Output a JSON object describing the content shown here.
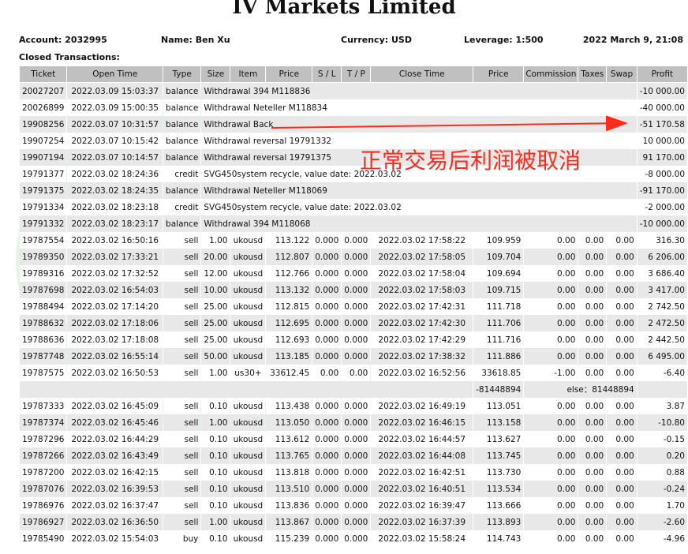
{
  "report_title": "IV Markets Limited",
  "account": {
    "account_label": "Account: 2032995",
    "name_label": "Name: Ben Xu",
    "currency_label": "Currency: USD",
    "leverage_label": "Leverage: 1:500",
    "datetime_label": "2022 March 9, 21:08"
  },
  "section_label": "Closed Transactions:",
  "columns": [
    "Ticket",
    "Open Time",
    "Type",
    "Size",
    "Item",
    "Price",
    "S / L",
    "T / P",
    "Close Time",
    "Price",
    "Commission",
    "Taxes",
    "Swap",
    "Profit"
  ],
  "balance_rows": [
    {
      "ticket": "20027207",
      "open_time": "2022.03.09 15:03:37",
      "type": "balance",
      "comment": "Withdrawal 394 M118836",
      "profit": "-10 000.00"
    },
    {
      "ticket": "20026899",
      "open_time": "2022.03.09 15:00:35",
      "type": "balance",
      "comment": "Withdrawal Neteller M118834",
      "profit": "-40 000.00"
    },
    {
      "ticket": "19908256",
      "open_time": "2022.03.07 10:31:57",
      "type": "balance",
      "comment": "Withdrawal Back",
      "profit": "-51 170.58"
    },
    {
      "ticket": "19907254",
      "open_time": "2022.03.07 10:15:42",
      "type": "balance",
      "comment": "Withdrawal reversal 19791332",
      "profit": "10 000.00"
    },
    {
      "ticket": "19907194",
      "open_time": "2022.03.07 10:14:57",
      "type": "balance",
      "comment": "Withdrawal reversal 19791375",
      "profit": "91 170.00"
    },
    {
      "ticket": "19791377",
      "open_time": "2022.03.02 18:24:36",
      "type": "credit",
      "comment": "SVG450system recycle, value date: 2022.03.02",
      "profit": "-8 000.00"
    },
    {
      "ticket": "19791375",
      "open_time": "2022.03.02 18:24:35",
      "type": "balance",
      "comment": "Withdrawal Neteller M118069",
      "profit": "-91 170.00"
    },
    {
      "ticket": "19791334",
      "open_time": "2022.03.02 18:23:18",
      "type": "credit",
      "comment": "SVG450system recycle, value date: 2022.03.02",
      "profit": "-2 000.00"
    },
    {
      "ticket": "19791332",
      "open_time": "2022.03.02 18:23:17",
      "type": "balance",
      "comment": "Withdrawal 394 M118068",
      "profit": "-10 000.00"
    }
  ],
  "trade_rows_a": [
    {
      "ticket": "19787554",
      "open_time": "2022.03.02 16:50:16",
      "type": "sell",
      "size": "1.00",
      "item": "ukousd",
      "price": "113.122",
      "sl": "0.000",
      "tp": "0.000",
      "close_time": "2022.03.02 17:58:22",
      "close_price": "109.959",
      "commission": "0.00",
      "taxes": "0.00",
      "swap": "0.00",
      "profit": "316.30"
    },
    {
      "ticket": "19789350",
      "open_time": "2022.03.02 17:33:21",
      "type": "sell",
      "size": "20.00",
      "item": "ukousd",
      "price": "112.807",
      "sl": "0.000",
      "tp": "0.000",
      "close_time": "2022.03.02 17:58:05",
      "close_price": "109.704",
      "commission": "0.00",
      "taxes": "0.00",
      "swap": "0.00",
      "profit": "6 206.00"
    },
    {
      "ticket": "19789316",
      "open_time": "2022.03.02 17:32:52",
      "type": "sell",
      "size": "12.00",
      "item": "ukousd",
      "price": "112.766",
      "sl": "0.000",
      "tp": "0.000",
      "close_time": "2022.03.02 17:58:04",
      "close_price": "109.694",
      "commission": "0.00",
      "taxes": "0.00",
      "swap": "0.00",
      "profit": "3 686.40"
    },
    {
      "ticket": "19787698",
      "open_time": "2022.03.02 16:54:03",
      "type": "sell",
      "size": "10.00",
      "item": "ukousd",
      "price": "113.132",
      "sl": "0.000",
      "tp": "0.000",
      "close_time": "2022.03.02 17:58:03",
      "close_price": "109.715",
      "commission": "0.00",
      "taxes": "0.00",
      "swap": "0.00",
      "profit": "3 417.00"
    },
    {
      "ticket": "19788494",
      "open_time": "2022.03.02 17:14:20",
      "type": "sell",
      "size": "25.00",
      "item": "ukousd",
      "price": "112.815",
      "sl": "0.000",
      "tp": "0.000",
      "close_time": "2022.03.02 17:42:31",
      "close_price": "111.718",
      "commission": "0.00",
      "taxes": "0.00",
      "swap": "0.00",
      "profit": "2 742.50"
    },
    {
      "ticket": "19788632",
      "open_time": "2022.03.02 17:18:06",
      "type": "sell",
      "size": "25.00",
      "item": "ukousd",
      "price": "112.695",
      "sl": "0.000",
      "tp": "0.000",
      "close_time": "2022.03.02 17:42:30",
      "close_price": "111.706",
      "commission": "0.00",
      "taxes": "0.00",
      "swap": "0.00",
      "profit": "2 472.50"
    },
    {
      "ticket": "19788636",
      "open_time": "2022.03.02 17:18:08",
      "type": "sell",
      "size": "25.00",
      "item": "ukousd",
      "price": "112.693",
      "sl": "0.000",
      "tp": "0.000",
      "close_time": "2022.03.02 17:42:29",
      "close_price": "111.716",
      "commission": "0.00",
      "taxes": "0.00",
      "swap": "0.00",
      "profit": "2 442.50"
    },
    {
      "ticket": "19787748",
      "open_time": "2022.03.02 16:55:14",
      "type": "sell",
      "size": "50.00",
      "item": "ukousd",
      "price": "113.185",
      "sl": "0.000",
      "tp": "0.000",
      "close_time": "2022.03.02 17:38:32",
      "close_price": "111.886",
      "commission": "0.00",
      "taxes": "0.00",
      "swap": "0.00",
      "profit": "6 495.00"
    },
    {
      "ticket": "19787575",
      "open_time": "2022.03.02 16:50:53",
      "type": "sell",
      "size": "1.00",
      "item": "us30+",
      "price": "33612.45",
      "sl": "0.00",
      "tp": "0.00",
      "close_time": "2022.03.02 16:52:56",
      "close_price": "33618.85",
      "commission": "-1.00",
      "taxes": "0.00",
      "swap": "0.00",
      "profit": "-6.40"
    }
  ],
  "sub_row": {
    "left_value": "-81448894",
    "right_value": "else：81448894"
  },
  "trade_rows_b": [
    {
      "ticket": "19787333",
      "open_time": "2022.03.02 16:45:09",
      "type": "sell",
      "size": "0.10",
      "item": "ukousd",
      "price": "113.438",
      "sl": "0.000",
      "tp": "0.000",
      "close_time": "2022.03.02 16:49:19",
      "close_price": "113.051",
      "commission": "0.00",
      "taxes": "0.00",
      "swap": "0.00",
      "profit": "3.87"
    },
    {
      "ticket": "19787374",
      "open_time": "2022.03.02 16:45:46",
      "type": "sell",
      "size": "1.00",
      "item": "ukousd",
      "price": "113.050",
      "sl": "0.000",
      "tp": "0.000",
      "close_time": "2022.03.02 16:46:15",
      "close_price": "113.158",
      "commission": "0.00",
      "taxes": "0.00",
      "swap": "0.00",
      "profit": "-10.80"
    },
    {
      "ticket": "19787296",
      "open_time": "2022.03.02 16:44:29",
      "type": "sell",
      "size": "0.10",
      "item": "ukousd",
      "price": "113.612",
      "sl": "0.000",
      "tp": "0.000",
      "close_time": "2022.03.02 16:44:57",
      "close_price": "113.627",
      "commission": "0.00",
      "taxes": "0.00",
      "swap": "0.00",
      "profit": "-0.15"
    },
    {
      "ticket": "19787266",
      "open_time": "2022.03.02 16:43:49",
      "type": "sell",
      "size": "0.10",
      "item": "ukousd",
      "price": "113.765",
      "sl": "0.000",
      "tp": "0.000",
      "close_time": "2022.03.02 16:44:08",
      "close_price": "113.745",
      "commission": "0.00",
      "taxes": "0.00",
      "swap": "0.00",
      "profit": "0.20"
    },
    {
      "ticket": "19787200",
      "open_time": "2022.03.02 16:42:15",
      "type": "sell",
      "size": "0.10",
      "item": "ukousd",
      "price": "113.818",
      "sl": "0.000",
      "tp": "0.000",
      "close_time": "2022.03.02 16:42:51",
      "close_price": "113.730",
      "commission": "0.00",
      "taxes": "0.00",
      "swap": "0.00",
      "profit": "0.88"
    },
    {
      "ticket": "19787076",
      "open_time": "2022.03.02 16:39:53",
      "type": "sell",
      "size": "0.10",
      "item": "ukousd",
      "price": "113.510",
      "sl": "0.000",
      "tp": "0.000",
      "close_time": "2022.03.02 16:40:51",
      "close_price": "113.534",
      "commission": "0.00",
      "taxes": "0.00",
      "swap": "0.00",
      "profit": "-0.24"
    },
    {
      "ticket": "19786976",
      "open_time": "2022.03.02 16:37:47",
      "type": "sell",
      "size": "0.10",
      "item": "ukousd",
      "price": "113.836",
      "sl": "0.000",
      "tp": "0.000",
      "close_time": "2022.03.02 16:39:47",
      "close_price": "113.666",
      "commission": "0.00",
      "taxes": "0.00",
      "swap": "0.00",
      "profit": "1.70"
    },
    {
      "ticket": "19786927",
      "open_time": "2022.03.02 16:36:50",
      "type": "sell",
      "size": "1.00",
      "item": "ukousd",
      "price": "113.867",
      "sl": "0.000",
      "tp": "0.000",
      "close_time": "2022.03.02 16:37:39",
      "close_price": "113.893",
      "commission": "0.00",
      "taxes": "0.00",
      "swap": "0.00",
      "profit": "-2.60"
    },
    {
      "ticket": "19785490",
      "open_time": "2022.03.02 15:54:03",
      "type": "buy",
      "size": "0.10",
      "item": "ukousd",
      "price": "115.239",
      "sl": "0.000",
      "tp": "0.000",
      "close_time": "2022.03.02 15:58:24",
      "close_price": "114.743",
      "commission": "0.00",
      "taxes": "0.00",
      "swap": "0.00",
      "profit": "-4.96"
    }
  ],
  "annotation": {
    "text": "正常交易后利润被取消",
    "color": "#ff2a1a"
  },
  "colors": {
    "header_bg": "#c0c0c0",
    "row_alt": "#e8e8e8",
    "annotation_red": "#ff2a1a"
  }
}
